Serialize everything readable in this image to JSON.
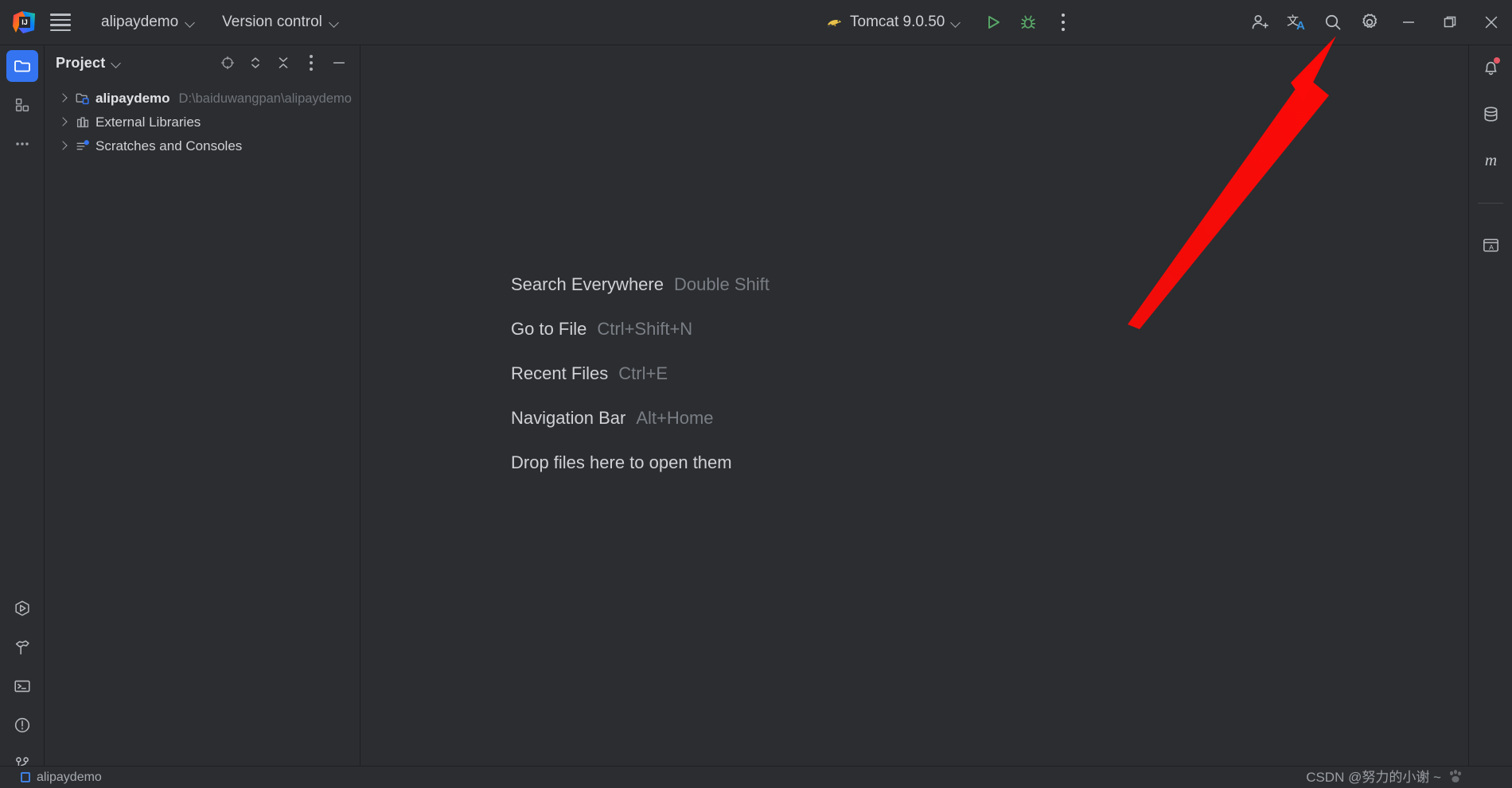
{
  "titlebar": {
    "logo_icon": "intellij-idea-logo",
    "menu_icon": "hamburger-menu-icon",
    "project_name": "alipaydemo",
    "vcs_label": "Version control",
    "run_config": "Tomcat 9.0.50",
    "run_config_icon": "tomcat-icon",
    "run_icon": "run-play-icon",
    "debug_icon": "debug-bug-icon",
    "more_icon": "more-vertical-icon",
    "add_user_icon": "add-user-icon",
    "translate_icon": "translate-icon",
    "search_icon": "search-icon",
    "settings_icon": "settings-gear-icon",
    "minimize_icon": "minimize-icon",
    "maximize_icon": "maximize-restore-icon",
    "close_icon": "close-icon"
  },
  "left_strip": {
    "top": [
      {
        "name": "project",
        "icon": "folder-icon",
        "active": true
      },
      {
        "name": "structure",
        "icon": "structure-blocks-icon",
        "active": false
      },
      {
        "name": "more-tool-windows",
        "icon": "more-horizontal-icon",
        "active": false
      }
    ],
    "bottom": [
      {
        "name": "run",
        "icon": "run-hexagon-icon"
      },
      {
        "name": "build",
        "icon": "hammer-icon"
      },
      {
        "name": "terminal",
        "icon": "terminal-icon"
      },
      {
        "name": "problems",
        "icon": "warning-circle-icon"
      },
      {
        "name": "version-control",
        "icon": "git-branch-icon"
      }
    ]
  },
  "project_panel": {
    "title": "Project",
    "title_chevron_icon": "chevron-down-icon",
    "tools": [
      {
        "name": "select-opened-file",
        "icon": "crosshair-target-icon"
      },
      {
        "name": "expand-collapse",
        "icon": "expand-collapse-chevrons-icon"
      },
      {
        "name": "collapse-all",
        "icon": "collapse-all-icon"
      },
      {
        "name": "options",
        "icon": "more-vertical-icon"
      },
      {
        "name": "hide",
        "icon": "minimize-line-icon"
      }
    ],
    "tree": [
      {
        "label": "alipaydemo",
        "path": "D:\\baiduwangpan\\alipaydemo",
        "icon": "module-folder-icon",
        "bold": true,
        "expanded": false
      },
      {
        "label": "External Libraries",
        "path": "",
        "icon": "libraries-icon",
        "bold": false,
        "expanded": false
      },
      {
        "label": "Scratches and Consoles",
        "path": "",
        "icon": "scratches-icon",
        "bold": false,
        "expanded": false
      }
    ]
  },
  "editor": {
    "hints": [
      {
        "name": "Search Everywhere",
        "shortcut": "Double Shift"
      },
      {
        "name": "Go to File",
        "shortcut": "Ctrl+Shift+N"
      },
      {
        "name": "Recent Files",
        "shortcut": "Ctrl+E"
      },
      {
        "name": "Navigation Bar",
        "shortcut": "Alt+Home"
      }
    ],
    "drop_hint": "Drop files here to open them"
  },
  "right_strip": {
    "items": [
      {
        "name": "notifications",
        "icon": "bell-icon",
        "badge": true
      },
      {
        "name": "database",
        "icon": "database-icon",
        "badge": false
      },
      {
        "name": "maven",
        "icon": "maven-m-icon",
        "badge": false
      },
      {
        "name": "translation",
        "icon": "translation-window-icon",
        "badge": false
      }
    ]
  },
  "statusbar": {
    "project_label": "alipaydemo",
    "project_icon": "project-square-icon"
  },
  "watermark": {
    "text": "CSDN @努力的小谢 ~",
    "icon": "paw-print-icon"
  },
  "annotation": {
    "name": "red-arrow-pointing-to-settings",
    "color": "#fb0a07",
    "points_to": "settings-gear-icon"
  }
}
